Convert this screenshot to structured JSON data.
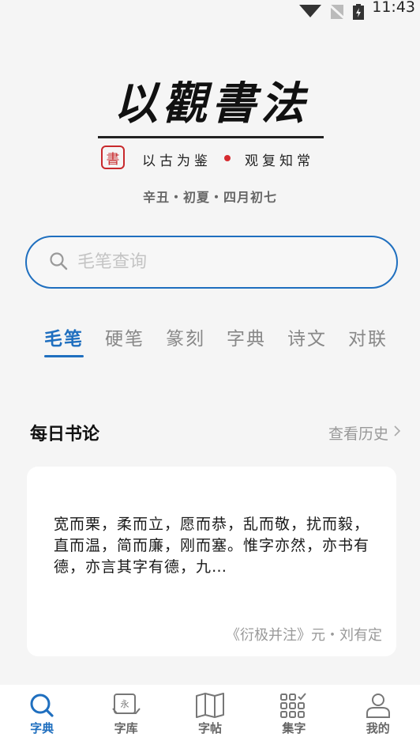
{
  "status_bar": {
    "time": "11:43"
  },
  "brand": {
    "title": "以觀書法",
    "seal_char": "書",
    "slogan_left": "以古为鉴",
    "slogan_right": "观复知常",
    "lunar_date": "辛丑・初夏・四月初七"
  },
  "search": {
    "placeholder": "毛笔查询"
  },
  "tabs": [
    {
      "label": "毛笔",
      "active": true
    },
    {
      "label": "硬笔"
    },
    {
      "label": "篆刻"
    },
    {
      "label": "字典"
    },
    {
      "label": "诗文"
    },
    {
      "label": "对联"
    }
  ],
  "daily": {
    "title": "每日书论",
    "history_label": "查看历史",
    "quote": "宽而栗，柔而立，愿而恭，乱而敬，扰而毅，直而温，简而廉，刚而塞。惟字亦然，亦书有德，亦言其字有德，九…",
    "source": "《衍极并注》元・刘有定"
  },
  "bottom_nav": [
    {
      "label": "字典",
      "icon": "search-icon",
      "active": true
    },
    {
      "label": "字库",
      "icon": "character-library-icon"
    },
    {
      "label": "字帖",
      "icon": "copybook-icon"
    },
    {
      "label": "集字",
      "icon": "grid-collect-icon"
    },
    {
      "label": "我的",
      "icon": "user-icon"
    }
  ],
  "colors": {
    "accent": "#1f6fbf",
    "seal_red": "#c8292c",
    "background": "#f5f5f5"
  }
}
